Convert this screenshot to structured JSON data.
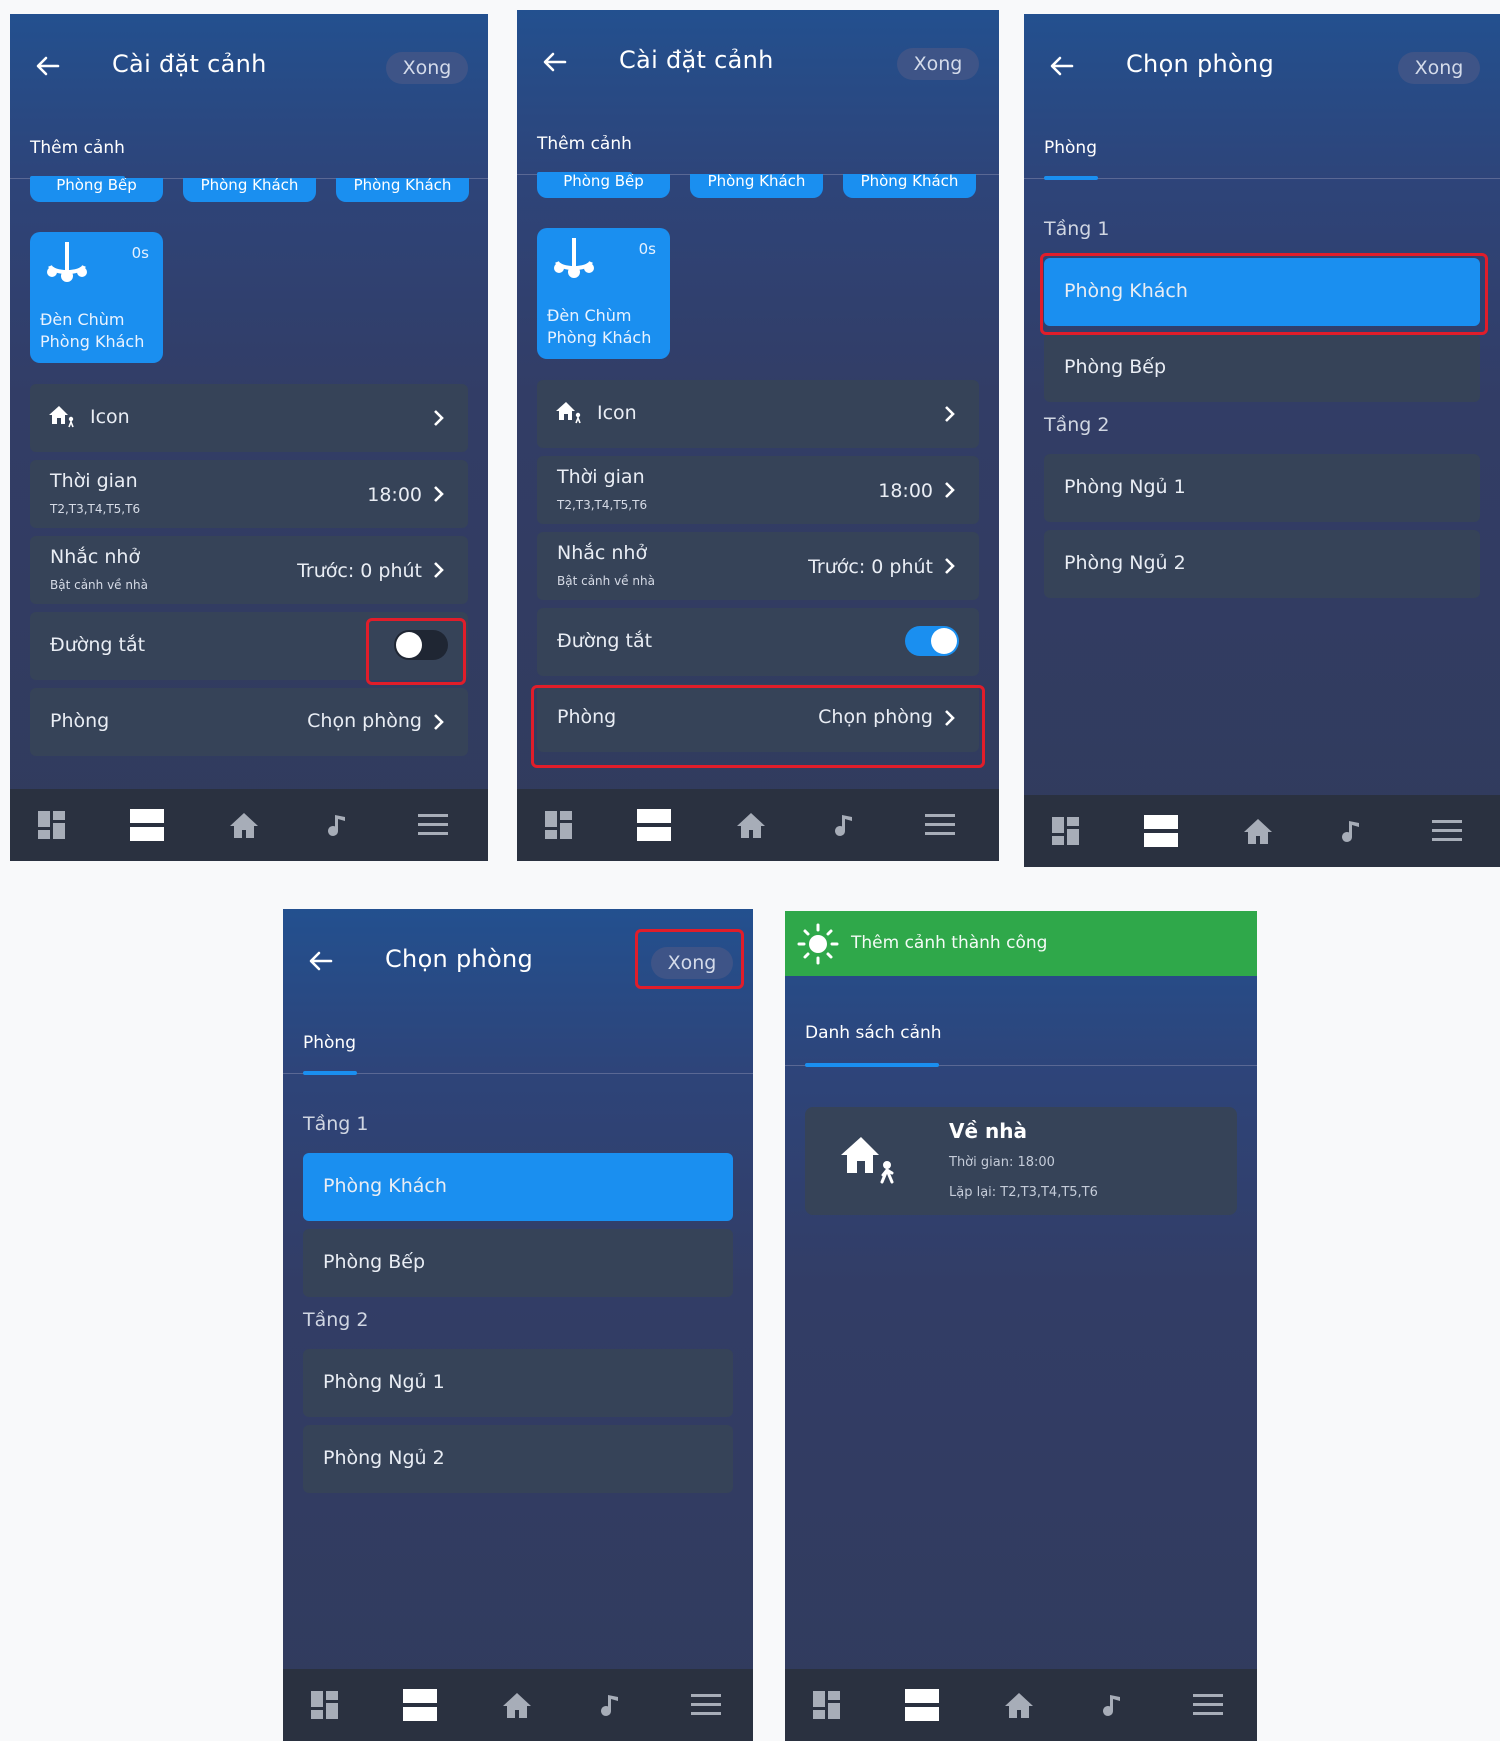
{
  "colors": {
    "accent": "#1a8ff0",
    "card": "#364358",
    "navbar": "#2a3140",
    "highlight": "#e11d2a",
    "success": "#2fa84a"
  },
  "setup": {
    "title": "Cài đặt cảnh",
    "done": "Xong",
    "tab": "Thêm cảnh",
    "chips": [
      "Phòng Bếp",
      "Phòng Khách",
      "Phòng Khách"
    ],
    "device": {
      "name1": "Đèn Chùm",
      "name2": "Phòng Khách",
      "time": "0s",
      "icon": "chandelier-icon"
    },
    "icon_row": {
      "label": "Icon",
      "icon": "home-person-icon"
    },
    "time_row": {
      "label": "Thời gian",
      "sub": "T2,T3,T4,T5,T6",
      "value": "18:00"
    },
    "remind_row": {
      "label": "Nhắc nhở",
      "sub": "Bật cảnh về nhà",
      "value": "Trước: 0 phút"
    },
    "shortcut_row": {
      "label": "Đường tắt"
    },
    "room_row": {
      "label": "Phòng",
      "value": "Chọn phòng"
    }
  },
  "s1": {
    "shortcut_on": false
  },
  "s2": {
    "shortcut_on": true
  },
  "rooms": {
    "title": "Chọn phòng",
    "done": "Xong",
    "tab": "Phòng",
    "floor1": "Tầng 1",
    "floor2": "Tầng 2",
    "items": [
      "Phòng Khách",
      "Phòng Bếp",
      "Phòng Ngủ 1",
      "Phòng Ngủ 2"
    ],
    "selected": "Phòng Khách"
  },
  "success": {
    "banner": "Thêm cảnh thành công",
    "tab": "Danh sách cảnh",
    "scene": {
      "name": "Về nhà",
      "time": "Thời gian: 18:00",
      "repeat": "Lặp lại: T2,T3,T4,T5,T6",
      "icon": "home-person-icon"
    }
  },
  "navbar": {
    "icons": [
      "dashboard-icon",
      "scenes-icon",
      "home-icon",
      "music-icon",
      "menu-icon"
    ],
    "active": "scenes-icon"
  }
}
